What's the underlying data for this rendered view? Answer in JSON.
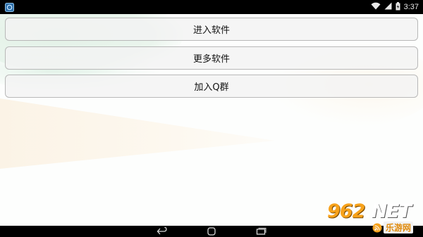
{
  "status_bar": {
    "time": "3:37",
    "icons": [
      "app-notification-icon",
      "wifi-icon",
      "signal-icon",
      "battery-charging-icon"
    ]
  },
  "menu": {
    "buttons": [
      {
        "label": "进入软件"
      },
      {
        "label": "更多软件"
      },
      {
        "label": "加入Q群"
      }
    ]
  },
  "nav_bar": {
    "icons": [
      "back-icon",
      "home-icon",
      "recent-apps-icon"
    ]
  },
  "watermark": {
    "number": "962",
    "dot": ".",
    "domain": "NET",
    "site_name": "乐游网",
    "colors": {
      "number": "#f7a21b",
      "site_name": "#e08a0a"
    }
  },
  "colors": {
    "status_bar_bg": "#000000",
    "button_border": "#b8b8b8",
    "button_bg": "#f3f3f3",
    "bg_green": "#e3f1e7",
    "bg_orange": "#fbf3e6"
  }
}
